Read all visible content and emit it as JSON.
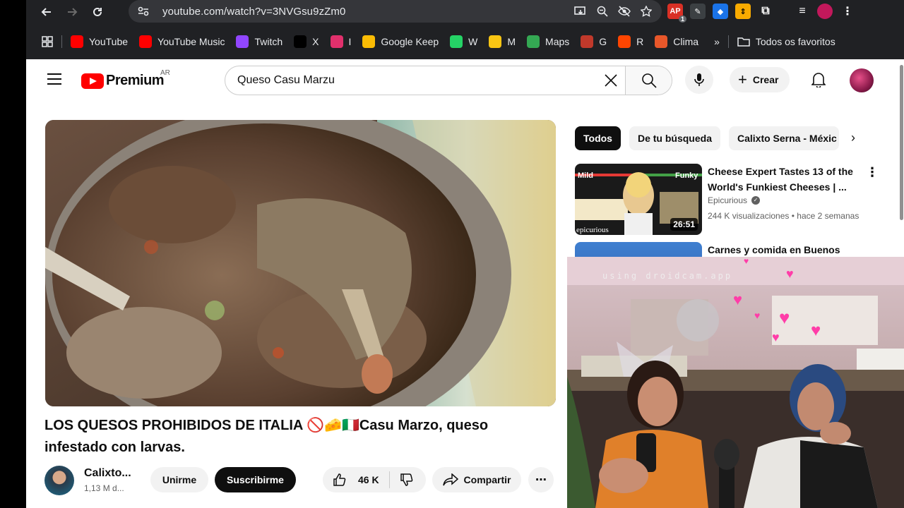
{
  "browser": {
    "url": "youtube.com/watch?v=3NVGsu9zZm0",
    "bookmarks": [
      {
        "label": "YouTube",
        "icon": "youtube-icon",
        "color": "#ff0000"
      },
      {
        "label": "YouTube Music",
        "icon": "youtube-music-icon",
        "color": "#ff0000"
      },
      {
        "label": "Twitch",
        "icon": "twitch-icon",
        "color": "#9146ff"
      },
      {
        "label": "X",
        "icon": "x-icon",
        "color": "#000000"
      },
      {
        "label": "I",
        "icon": "instagram-icon",
        "color": "#e1306c"
      },
      {
        "label": "Google Keep",
        "icon": "keep-icon",
        "color": "#fbbc04"
      },
      {
        "label": "W",
        "icon": "whatsapp-icon",
        "color": "#25d366"
      },
      {
        "label": "M",
        "icon": "maps-pin-icon",
        "color": "#f9c513"
      },
      {
        "label": "Maps",
        "icon": "google-maps-icon",
        "color": "#34a853"
      },
      {
        "label": "G",
        "icon": "g-icon",
        "color": "#c0392b"
      },
      {
        "label": "R",
        "icon": "reddit-icon",
        "color": "#ff4500"
      },
      {
        "label": "Clima",
        "icon": "weather-icon",
        "color": "#e8572a"
      }
    ],
    "all_bookmarks_label": "Todos os favoritos",
    "ext_badge": "1"
  },
  "youtube": {
    "logo_text": "Premium",
    "country": "AR",
    "search_value": "Queso Casu Marzu",
    "create_label": "Crear",
    "video": {
      "title": "LOS QUESOS PROHIBIDOS DE ITALIA 🚫🧀🇮🇹Casu Marzo, queso infestado con larvas.",
      "channel": "Calixto...",
      "subscribers": "1,13 M d...",
      "join_label": "Unirme",
      "subscribe_label": "Suscribirme",
      "likes": "46 K",
      "share_label": "Compartir"
    },
    "chips": [
      "Todos",
      "De tu búsqueda",
      "Calixto Serna - Méxic"
    ],
    "recommendations": [
      {
        "title": "Cheese Expert Tastes 13 of the World's Funkiest Cheeses | ...",
        "channel": "Epicurious",
        "meta": "244 K visualizaciones • hace 2 semanas",
        "duration": "26:51",
        "thumb_left": "Mild",
        "thumb_right": "Funky",
        "thumb_brand": "epicurious"
      },
      {
        "title": "Carnes y comida en Buenos",
        "channel": "",
        "meta": "",
        "duration": ""
      }
    ]
  },
  "webcam": {
    "watermark": "using droidcam.app"
  }
}
